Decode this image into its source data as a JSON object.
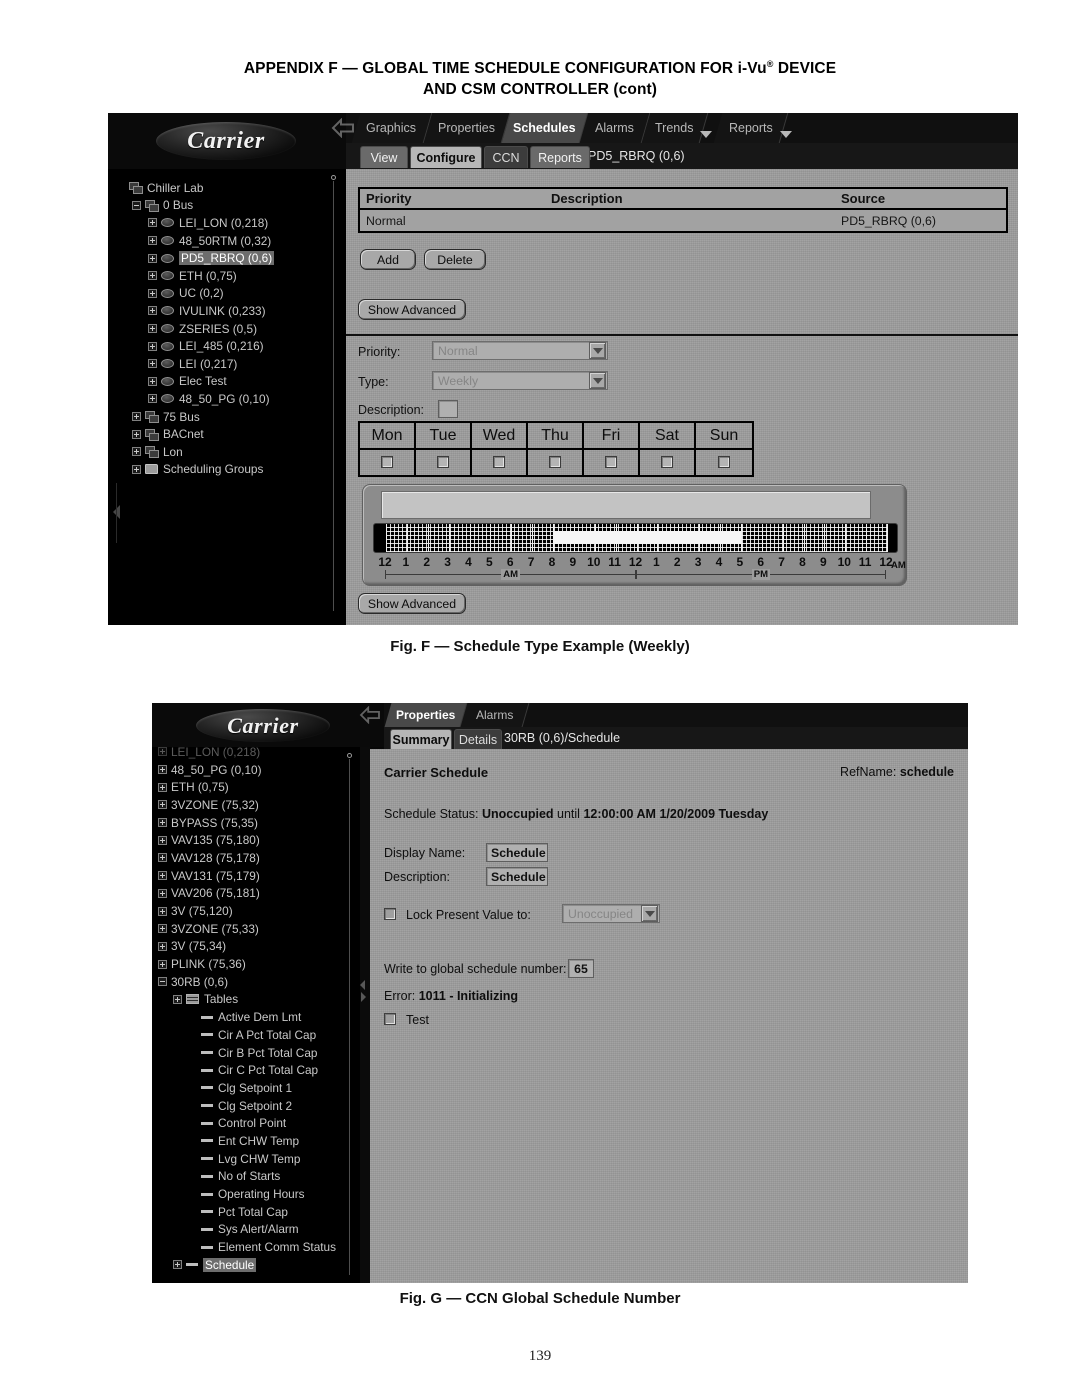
{
  "document": {
    "title_line1_a": "APPENDIX F — GLOBAL TIME SCHEDULE CONFIGURATION FOR i-Vu",
    "title_line1_sup": "®",
    "title_line1_b": " DEVICE",
    "title_line2": "AND CSM CONTROLLER (cont)",
    "page_number": "139",
    "figure_f_caption": "Fig. F — Schedule Type Example (Weekly)",
    "figure_g_caption": "Fig. G — CCN Global Schedule Number"
  },
  "figure_f": {
    "brand": "Carrier",
    "primary_tabs": [
      {
        "label": "Graphics",
        "active": false,
        "caret": false
      },
      {
        "label": "Properties",
        "active": false,
        "caret": false
      },
      {
        "label": "Schedules",
        "active": true,
        "caret": false
      },
      {
        "label": "Alarms",
        "active": false,
        "caret": false
      },
      {
        "label": "Trends",
        "active": false,
        "caret": true
      },
      {
        "label": "Reports",
        "active": false,
        "caret": true
      }
    ],
    "secondary_tabs": [
      {
        "label": "View",
        "state": "dim2"
      },
      {
        "label": "Configure",
        "state": "on"
      },
      {
        "label": "CCN",
        "state": "dim"
      },
      {
        "label": "Reports",
        "state": "dim2"
      }
    ],
    "secondary_title": "PD5_RBRQ (0,6)",
    "tree": [
      {
        "label": "Chiller Lab",
        "depth": 0,
        "toggle": "none",
        "icon": "bus-icon",
        "selected": false
      },
      {
        "label": "0 Bus",
        "depth": 1,
        "toggle": "minus",
        "icon": "bus-icon",
        "selected": false
      },
      {
        "label": "LEI_LON (0,218)",
        "depth": 2,
        "toggle": "plus",
        "icon": "device-icon",
        "selected": false
      },
      {
        "label": "48_50RTM (0,32)",
        "depth": 2,
        "toggle": "plus",
        "icon": "device-icon",
        "selected": false
      },
      {
        "label": "PD5_RBRQ (0,6)",
        "depth": 2,
        "toggle": "plus",
        "icon": "device-icon",
        "selected": true
      },
      {
        "label": "ETH (0,75)",
        "depth": 2,
        "toggle": "plus",
        "icon": "device-icon",
        "selected": false
      },
      {
        "label": "UC (0,2)",
        "depth": 2,
        "toggle": "plus",
        "icon": "device-icon",
        "selected": false
      },
      {
        "label": "IVULINK (0,233)",
        "depth": 2,
        "toggle": "plus",
        "icon": "device-icon",
        "selected": false
      },
      {
        "label": "ZSERIES (0,5)",
        "depth": 2,
        "toggle": "plus",
        "icon": "device-icon",
        "selected": false
      },
      {
        "label": "LEI_485 (0,216)",
        "depth": 2,
        "toggle": "plus",
        "icon": "device-icon",
        "selected": false
      },
      {
        "label": "LEI (0,217)",
        "depth": 2,
        "toggle": "plus",
        "icon": "device-icon",
        "selected": false
      },
      {
        "label": "Elec Test",
        "depth": 2,
        "toggle": "plus",
        "icon": "device-icon",
        "selected": false
      },
      {
        "label": "48_50_PG (0,10)",
        "depth": 2,
        "toggle": "plus",
        "icon": "device-icon",
        "selected": false
      },
      {
        "label": "75 Bus",
        "depth": 1,
        "toggle": "plus",
        "icon": "bus-icon",
        "selected": false
      },
      {
        "label": "BACnet",
        "depth": 1,
        "toggle": "plus",
        "icon": "bus-icon",
        "selected": false
      },
      {
        "label": "Lon",
        "depth": 1,
        "toggle": "plus",
        "icon": "bus-icon",
        "selected": false
      },
      {
        "label": "Scheduling Groups",
        "depth": 1,
        "toggle": "plus",
        "icon": "folder-icon",
        "selected": false
      }
    ],
    "priority_table": {
      "headers": [
        "Priority",
        "Description",
        "Source"
      ],
      "rows": [
        {
          "priority": "Normal",
          "description": "",
          "source": "PD5_RBRQ (0,6)"
        }
      ]
    },
    "buttons": {
      "add": "Add",
      "delete": "Delete",
      "show_advanced_top": "Show Advanced",
      "show_advanced_bottom": "Show Advanced"
    },
    "form": {
      "priority_label": "Priority:",
      "priority_value": "Normal",
      "type_label": "Type:",
      "type_value": "Weekly",
      "description_label": "Description:",
      "description_value": ""
    },
    "days": [
      {
        "label": "Mon",
        "checked": false
      },
      {
        "label": "Tue",
        "checked": false
      },
      {
        "label": "Wed",
        "checked": false
      },
      {
        "label": "Thu",
        "checked": false
      },
      {
        "label": "Fri",
        "checked": false
      },
      {
        "label": "Sat",
        "checked": false
      },
      {
        "label": "Sun",
        "checked": false
      }
    ],
    "timeline": {
      "hour_labels": [
        "12",
        "1",
        "2",
        "3",
        "4",
        "5",
        "6",
        "7",
        "8",
        "9",
        "10",
        "11",
        "12",
        "1",
        "2",
        "3",
        "4",
        "5",
        "6",
        "7",
        "8",
        "9",
        "10",
        "11",
        "12"
      ],
      "am_label": "AM",
      "pm_label": "PM",
      "trailing_label": "AM",
      "occupied_start_hour": 8,
      "occupied_end_hour": 17
    }
  },
  "figure_g": {
    "brand": "Carrier",
    "primary_tabs": [
      {
        "label": "Properties",
        "active": true,
        "caret": false
      },
      {
        "label": "Alarms",
        "active": false,
        "caret": false
      }
    ],
    "secondary_tabs": [
      {
        "label": "Summary",
        "state": "on"
      },
      {
        "label": "Details",
        "state": "dim"
      }
    ],
    "secondary_title": "30RB (0,6)/Schedule",
    "tree": [
      {
        "label": "LEI_LON (0,218)",
        "depth": 0,
        "toggle": "plus",
        "icon": "none",
        "selected": false,
        "clipped": true
      },
      {
        "label": "48_50_PG (0,10)",
        "depth": 0,
        "toggle": "plus",
        "icon": "none",
        "selected": false
      },
      {
        "label": "ETH (0,75)",
        "depth": 0,
        "toggle": "plus",
        "icon": "none",
        "selected": false
      },
      {
        "label": "3VZONE (75,32)",
        "depth": 0,
        "toggle": "plus",
        "icon": "none",
        "selected": false
      },
      {
        "label": "BYPASS (75,35)",
        "depth": 0,
        "toggle": "plus",
        "icon": "none",
        "selected": false
      },
      {
        "label": "VAV135 (75,180)",
        "depth": 0,
        "toggle": "plus",
        "icon": "none",
        "selected": false
      },
      {
        "label": "VAV128 (75,178)",
        "depth": 0,
        "toggle": "plus",
        "icon": "none",
        "selected": false
      },
      {
        "label": "VAV131 (75,179)",
        "depth": 0,
        "toggle": "plus",
        "icon": "none",
        "selected": false
      },
      {
        "label": "VAV206 (75,181)",
        "depth": 0,
        "toggle": "plus",
        "icon": "none",
        "selected": false
      },
      {
        "label": "3V (75,120)",
        "depth": 0,
        "toggle": "plus",
        "icon": "none",
        "selected": false
      },
      {
        "label": "3VZONE (75,33)",
        "depth": 0,
        "toggle": "plus",
        "icon": "none",
        "selected": false
      },
      {
        "label": "3V (75,34)",
        "depth": 0,
        "toggle": "plus",
        "icon": "none",
        "selected": false
      },
      {
        "label": "PLINK (75,36)",
        "depth": 0,
        "toggle": "plus",
        "icon": "none",
        "selected": false
      },
      {
        "label": "30RB (0,6)",
        "depth": 0,
        "toggle": "minus",
        "icon": "none",
        "selected": false
      },
      {
        "label": "Tables",
        "depth": 1,
        "toggle": "plus",
        "icon": "table-icon",
        "selected": false
      },
      {
        "label": "Active Dem Lmt",
        "depth": 2,
        "toggle": "none",
        "icon": "dash-icon",
        "selected": false
      },
      {
        "label": "Cir A Pct Total Cap",
        "depth": 2,
        "toggle": "none",
        "icon": "dash-icon",
        "selected": false
      },
      {
        "label": "Cir B Pct Total Cap",
        "depth": 2,
        "toggle": "none",
        "icon": "dash-icon",
        "selected": false
      },
      {
        "label": "Cir C Pct Total Cap",
        "depth": 2,
        "toggle": "none",
        "icon": "dash-icon",
        "selected": false
      },
      {
        "label": "Clg Setpoint 1",
        "depth": 2,
        "toggle": "none",
        "icon": "dash-icon",
        "selected": false
      },
      {
        "label": "Clg Setpoint 2",
        "depth": 2,
        "toggle": "none",
        "icon": "dash-icon",
        "selected": false
      },
      {
        "label": "Control Point",
        "depth": 2,
        "toggle": "none",
        "icon": "dash-icon",
        "selected": false
      },
      {
        "label": "Ent CHW Temp",
        "depth": 2,
        "toggle": "none",
        "icon": "dash-icon",
        "selected": false
      },
      {
        "label": "Lvg CHW Temp",
        "depth": 2,
        "toggle": "none",
        "icon": "dash-icon",
        "selected": false
      },
      {
        "label": "No of Starts",
        "depth": 2,
        "toggle": "none",
        "icon": "dash-icon",
        "selected": false
      },
      {
        "label": "Operating Hours",
        "depth": 2,
        "toggle": "none",
        "icon": "dash-icon",
        "selected": false
      },
      {
        "label": "Pct Total Cap",
        "depth": 2,
        "toggle": "none",
        "icon": "dash-icon",
        "selected": false
      },
      {
        "label": "Sys Alert/Alarm",
        "depth": 2,
        "toggle": "none",
        "icon": "dash-icon",
        "selected": false
      },
      {
        "label": "Element Comm Status",
        "depth": 2,
        "toggle": "none",
        "icon": "dash-icon",
        "selected": false
      },
      {
        "label": "Schedule",
        "depth": 1,
        "toggle": "plus",
        "icon": "dash-icon",
        "selected": true
      }
    ],
    "content": {
      "heading": "Carrier Schedule",
      "refname_label": "RefName:",
      "refname_value": "schedule",
      "status_label": "Schedule Status:",
      "status_value": "Unoccupied",
      "status_until": "until",
      "status_time": "12:00:00 AM",
      "status_date": "1/20/2009 Tuesday",
      "display_name_label": "Display Name:",
      "display_name_value": "Schedule",
      "description_label": "Description:",
      "description_value": "Schedule",
      "lock_label": "Lock Present Value to:",
      "lock_value": "Unoccupied",
      "lock_checked": false,
      "global_label": "Write to global schedule number:",
      "global_value": "65",
      "error_label": "Error:",
      "error_value": "1011 - Initializing",
      "test_label": "Test",
      "test_checked": false
    }
  }
}
